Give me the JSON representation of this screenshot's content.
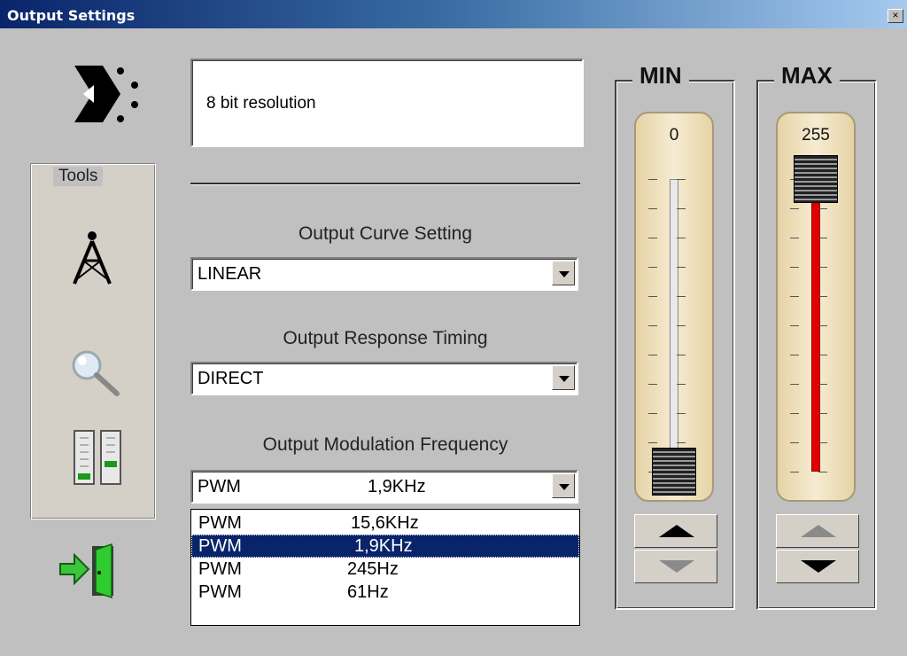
{
  "window": {
    "title": "Output Settings",
    "close_label": "×"
  },
  "info": {
    "text": "8 bit resolution"
  },
  "tools": {
    "legend": "Tools",
    "icons": [
      "antenna-tower-icon",
      "magnifier-icon",
      "level-meter-icon"
    ]
  },
  "exit": {
    "icon": "exit-door-icon"
  },
  "curve": {
    "label": "Output Curve Setting",
    "value": "LINEAR"
  },
  "timing": {
    "label": "Output Response Timing",
    "value": "DIRECT"
  },
  "modulation": {
    "label": "Output Modulation Frequency",
    "value_type": "PWM",
    "value_freq": "1,9KHz",
    "options": [
      {
        "type": "PWM",
        "freq": "15,6KHz",
        "selected": false
      },
      {
        "type": "PWM",
        "freq": "1,9KHz",
        "selected": true
      },
      {
        "type": "PWM",
        "freq": "245Hz",
        "selected": false
      },
      {
        "type": "PWM",
        "freq": "61Hz",
        "selected": false
      }
    ]
  },
  "min": {
    "label": "MIN",
    "value": "0",
    "level": 0,
    "up_enabled": true,
    "down_enabled": false
  },
  "max": {
    "label": "MAX",
    "value": "255",
    "level": 1,
    "up_enabled": false,
    "down_enabled": true
  },
  "colors": {
    "accent_red": "#e00000",
    "selection": "#0a246a",
    "track_bg": "#f3e5c2"
  }
}
